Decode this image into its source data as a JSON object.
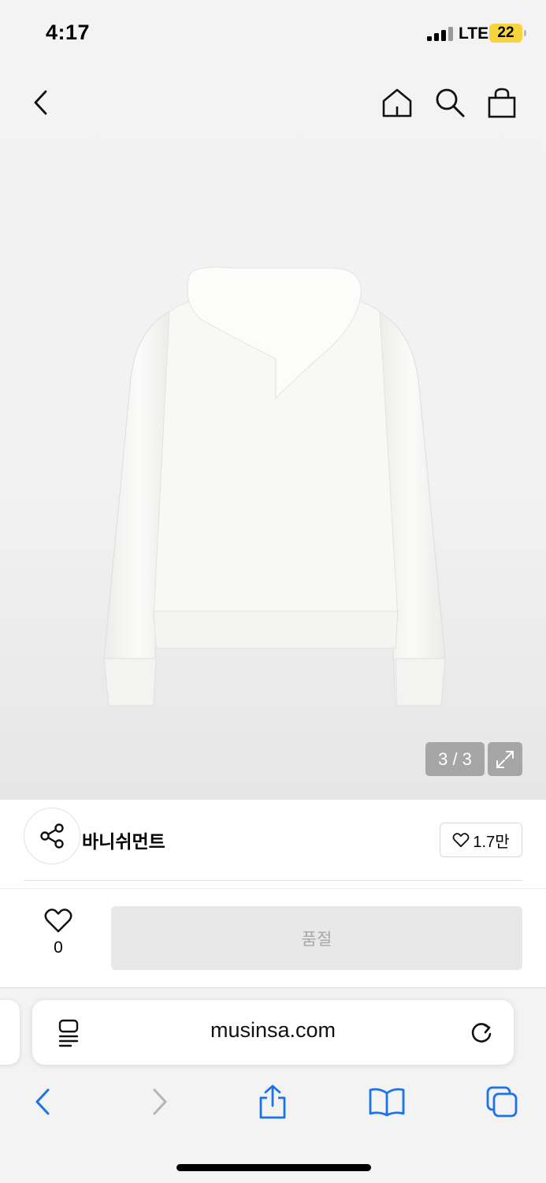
{
  "status_bar": {
    "time": "4:17",
    "network": "LTE",
    "battery": "22"
  },
  "nav": {
    "back_icon": "chevron-left-icon",
    "home_icon": "home-icon",
    "search_icon": "search-icon",
    "cart_icon": "shopping-bag-icon"
  },
  "gallery": {
    "counter": "3 / 3",
    "expand_icon": "expand-icon"
  },
  "brand": {
    "name": "바니쉬먼트",
    "like_count": "1.7만",
    "share_icon": "share-icon"
  },
  "purchase": {
    "wish_count": "0",
    "soldout_label": "품절"
  },
  "browser": {
    "url": "musinsa.com"
  },
  "colors": {
    "safari_blue": "#1a73e8",
    "soldout_bg": "#e8e8e8",
    "battery_yellow": "#f5d43c"
  }
}
